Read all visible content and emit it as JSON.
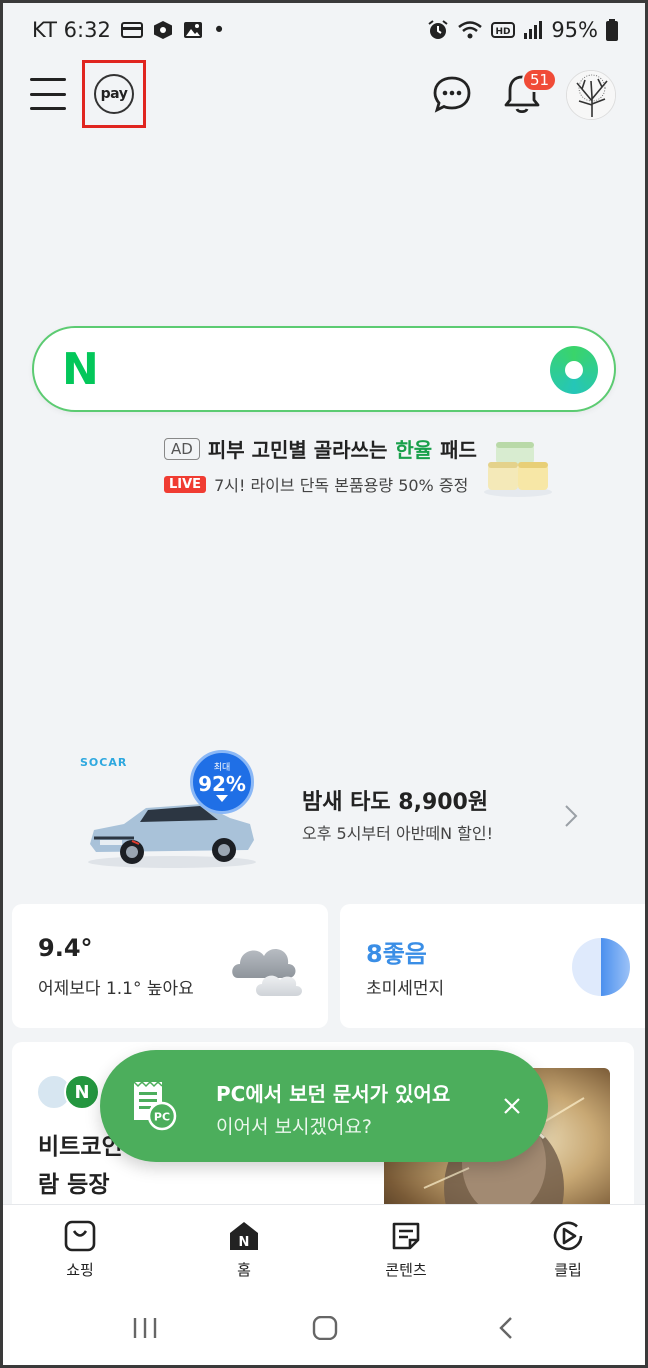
{
  "status_bar": {
    "carrier_time": "KT 6:32",
    "dot": "•",
    "battery": "95%",
    "icons": [
      "wallet-icon",
      "package-icon",
      "image-icon",
      "alarm-icon",
      "wifi-icon",
      "hd-icon",
      "signal-icon",
      "battery-icon"
    ]
  },
  "header": {
    "pay_label": "pay",
    "notification_count": "51",
    "icons": [
      "menu-icon",
      "chat-icon",
      "bell-icon",
      "profile-avatar"
    ]
  },
  "search": {
    "logo": "N",
    "icons": [
      "green-dot-icon"
    ]
  },
  "ad": {
    "tag": "AD",
    "title_part1": "피부 고민별 골라쓰는",
    "title_highlight": "한율",
    "title_part2": "패드",
    "live_tag": "LIVE",
    "subtitle": "7시! 라이브 단독 본품용량 50% 증정"
  },
  "promo": {
    "brand": "SOCAR",
    "discount_prefix": "최대",
    "discount": "92%",
    "title": "밤새 타도 8,900원",
    "subtitle": "오후 5시부터 아반떼N 할인!"
  },
  "weather": {
    "temperature": "9.4°",
    "comparison": "어제보다 1.1° 높아요"
  },
  "dust": {
    "value": "8좋음",
    "label": "초미세먼지"
  },
  "news": {
    "badge": "N",
    "title": "비트코인 사람 등장"
  },
  "toast": {
    "title": "PC에서 보던 문서가 있어요",
    "subtitle": "이어서 보시겠어요?",
    "icon_text": "PC"
  },
  "bottom_nav": {
    "items": [
      {
        "label": "쇼핑"
      },
      {
        "label": "홈"
      },
      {
        "label": "콘텐츠"
      },
      {
        "label": "클립"
      }
    ]
  },
  "colors": {
    "naver_green": "#03c75a",
    "toast_green": "#4cae5c",
    "badge_red": "#f04b37",
    "dust_blue": "#3a8ee6",
    "highlight_box": "#e0251f"
  }
}
